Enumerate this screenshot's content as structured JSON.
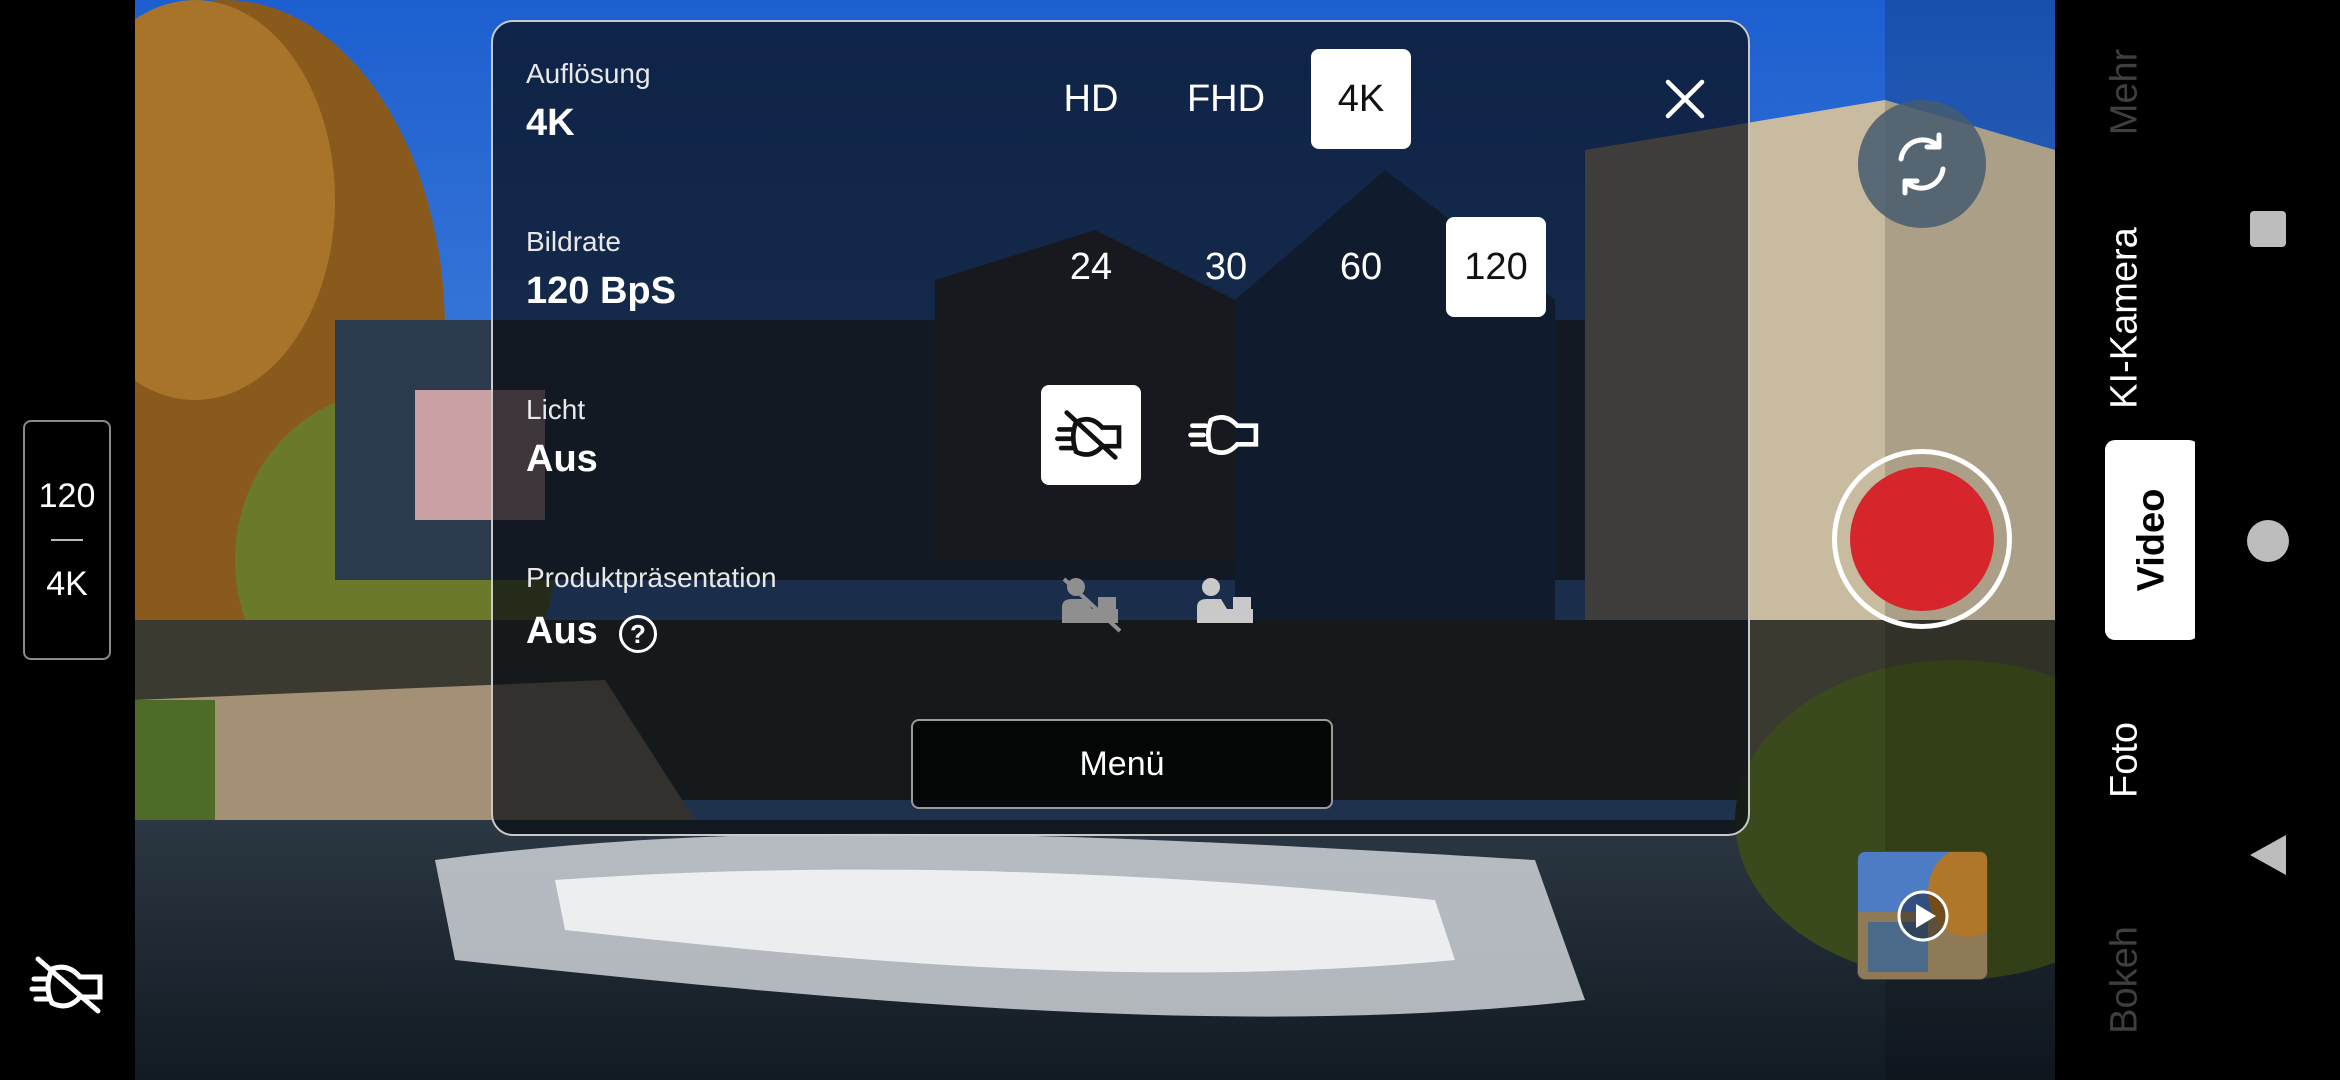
{
  "quick_settings": {
    "framerate": "120",
    "resolution": "4K"
  },
  "panel": {
    "resolution": {
      "label": "Auflösung",
      "value": "4K",
      "options": [
        "HD",
        "FHD",
        "4K"
      ],
      "selected": "4K"
    },
    "framerate": {
      "label": "Bildrate",
      "value": "120 BpS",
      "options": [
        "24",
        "30",
        "60",
        "120"
      ],
      "selected": "120"
    },
    "light": {
      "label": "Licht",
      "value": "Aus",
      "options": [
        "flash-off-icon",
        "flash-on-icon"
      ],
      "selected": "flash-off-icon"
    },
    "product_showcase": {
      "label": "Produktpräsentation",
      "value": "Aus",
      "help": "?",
      "options": [
        "product-showcase-off-icon",
        "product-showcase-on-icon"
      ]
    },
    "menu_label": "Menü"
  },
  "modes": {
    "more": "Mehr",
    "ai_camera": "KI-Kamera",
    "video": "Video",
    "photo": "Foto",
    "bokeh": "Bokeh",
    "selected": "Video"
  },
  "colors": {
    "record": "#d6262b",
    "panel_border": "#c9c9c9",
    "selected_option_bg": "#ffffff"
  }
}
